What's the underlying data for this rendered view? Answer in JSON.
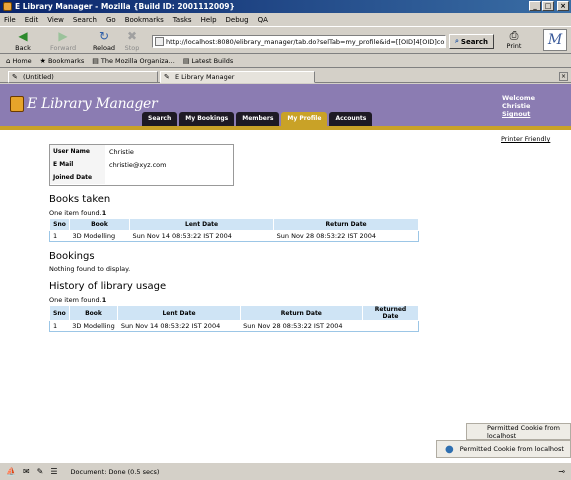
{
  "window": {
    "title": "E Library Manager - Mozilla {Build ID: 2001112009}",
    "min_btn": "_",
    "max_btn": "□",
    "close_btn": "×"
  },
  "menu": [
    "File",
    "Edit",
    "View",
    "Search",
    "Go",
    "Bookmarks",
    "Tasks",
    "Help",
    "Debug",
    "QA"
  ],
  "nav": {
    "back": "Back",
    "forward": "Forward",
    "reload": "Reload",
    "stop": "Stop",
    "url": "http://localhost:8080/elibrary_manager/tab.do?selTab=my_profile&id=[[OID]4[OID]com.kor",
    "search": "Search",
    "print": "Print",
    "throbber": "M"
  },
  "personal": [
    "Home",
    "Bookmarks",
    "The Mozilla Organiza...",
    "Latest Builds"
  ],
  "tabs": [
    "(Untitled)",
    "E Library Manager"
  ],
  "app": {
    "logo": "E Library Manager",
    "nav": [
      "Search",
      "My Bookings",
      "Members",
      "My Profile",
      "Accounts"
    ],
    "active_nav": "My Profile",
    "welcome": "Welcome",
    "user": "Christie",
    "signout": "Signout",
    "printer_friendly": "Printer Friendly"
  },
  "profile": [
    {
      "label": "User Name",
      "value": "Christie"
    },
    {
      "label": "E Mail",
      "value": "christie@xyz.com"
    },
    {
      "label": "Joined Date",
      "value": ""
    }
  ],
  "books_taken": {
    "title": "Books taken",
    "found_prefix": "One item found.",
    "found_count": "1",
    "headers": [
      "Sno",
      "Book",
      "Lent Date",
      "Return Date"
    ],
    "rows": [
      [
        "1",
        "3D Modelling",
        "Sun Nov 14 08:53:22 IST 2004",
        "Sun Nov 28 08:53:22 IST 2004"
      ]
    ]
  },
  "bookings": {
    "title": "Bookings",
    "empty": "Nothing found to display."
  },
  "history": {
    "title": "History of library usage",
    "found_prefix": "One item found.",
    "found_count": "1",
    "headers": [
      "Sno",
      "Book",
      "Lent Date",
      "Return Date",
      "Returned Date"
    ],
    "rows": [
      [
        "1",
        "3D Modelling",
        "Sun Nov 14 08:53:22 IST 2004",
        "Sun Nov 28 08:53:22 IST 2004",
        ""
      ]
    ]
  },
  "cookies": [
    "Permitted Cookie from localhost",
    "Permitted Cookie from localhost"
  ],
  "status": {
    "message": "Document: Done (0.5 secs)"
  },
  "colors": {
    "header": "#8b7cb2",
    "accent": "#c9a227",
    "tab_dark": "#1e1a24",
    "table_head": "#cfe4f5"
  }
}
